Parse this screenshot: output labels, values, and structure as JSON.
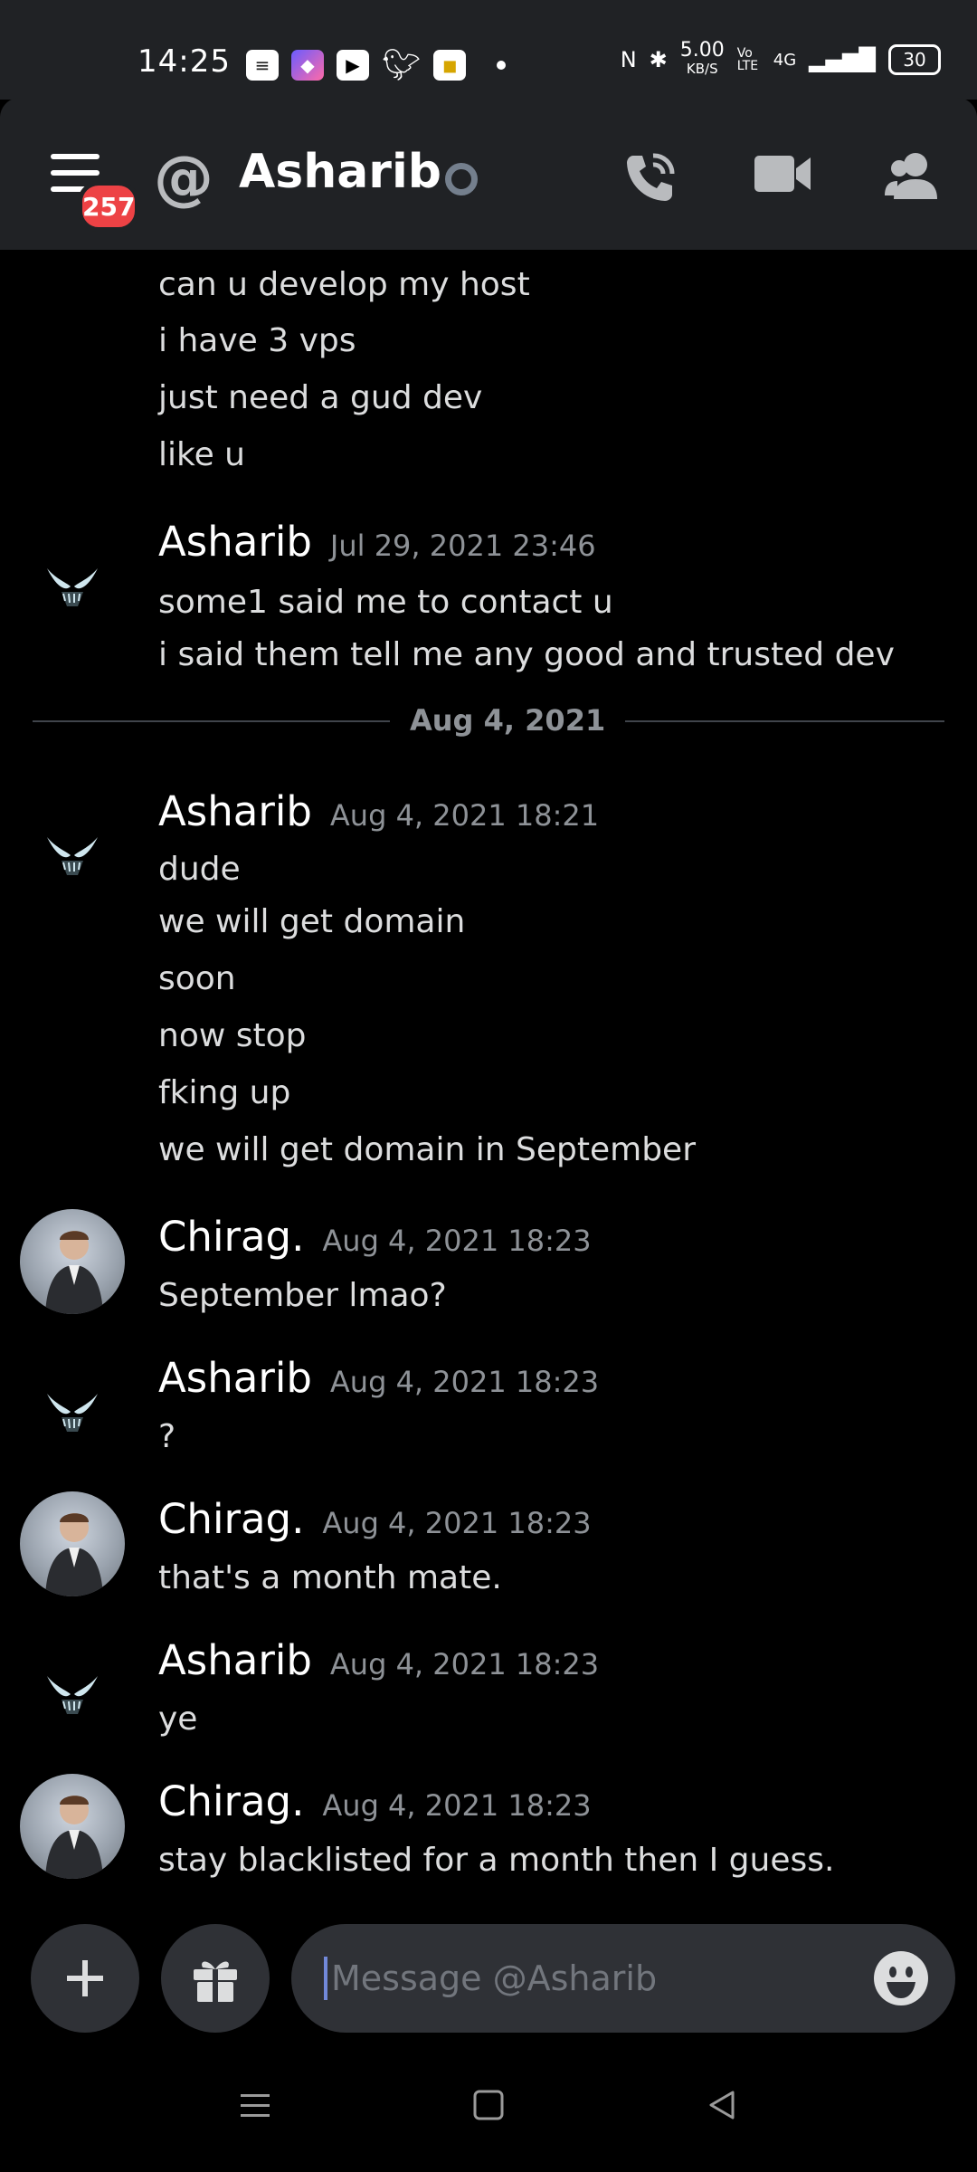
{
  "status_bar": {
    "time": "14:25",
    "speed_value": "5.00",
    "speed_unit": "KB/S",
    "volte": "Vo LTE",
    "network": "4G",
    "battery": "30"
  },
  "header": {
    "badge_count": "257",
    "channel_title": "Asharib"
  },
  "messages": {
    "g1_lines": [
      "can u develop my host",
      "i have 3 vps",
      "just need a gud dev",
      "like u"
    ],
    "g2_author": "Asharib",
    "g2_time": "Jul 29, 2021 23:46",
    "g2_lines": [
      "some1 said me to contact u",
      "i said them tell me any good and trusted dev"
    ],
    "divider_date": "Aug 4, 2021",
    "g3_author": "Asharib",
    "g3_time": "Aug 4, 2021 18:21",
    "g3_lines": [
      "dude",
      "we will get domain",
      "soon",
      "now stop",
      "fking up",
      "we will get domain in September"
    ],
    "g4_author": "Chirag.",
    "g4_time": "Aug 4, 2021 18:23",
    "g4_lines": [
      "September lmao?"
    ],
    "g5_author": "Asharib",
    "g5_time": "Aug 4, 2021 18:23",
    "g5_lines": [
      "?"
    ],
    "g6_author": "Chirag.",
    "g6_time": "Aug 4, 2021 18:23",
    "g6_lines": [
      "that's a month mate."
    ],
    "g7_author": "Asharib",
    "g7_time": "Aug 4, 2021 18:23",
    "g7_lines": [
      "ye"
    ],
    "g8_author": "Chirag.",
    "g8_time": "Aug 4, 2021 18:23",
    "g8_lines": [
      "stay blacklisted for a month then I guess."
    ]
  },
  "composer": {
    "placeholder": "Message @Asharib"
  },
  "colors": {
    "background": "#000000",
    "header": "#202225",
    "input": "#2f3136",
    "badge": "#ed4245",
    "timestamp": "#8e9297"
  }
}
